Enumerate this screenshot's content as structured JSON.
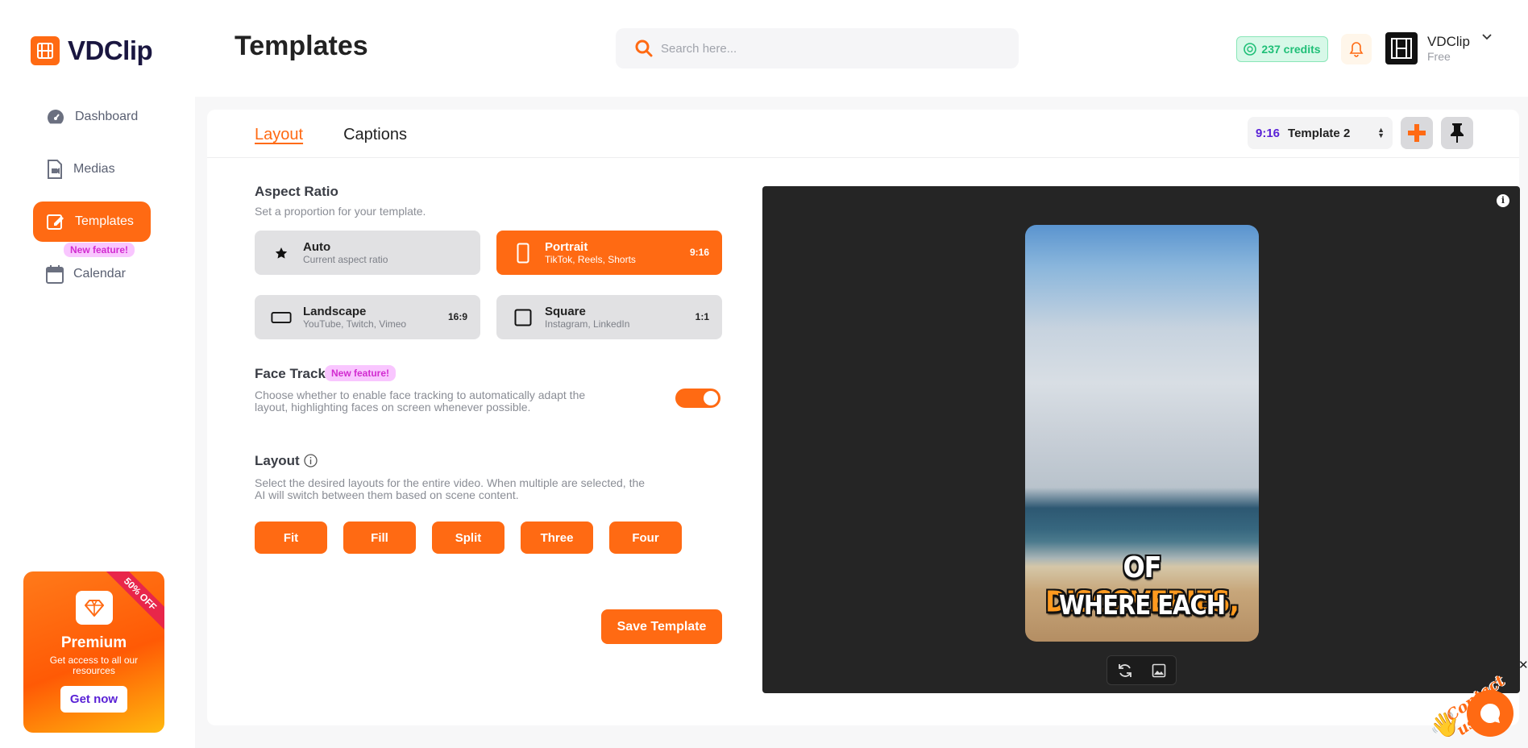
{
  "app": {
    "name": "VDClip"
  },
  "sidebar": {
    "items": [
      {
        "label": "Dashboard",
        "icon": "gauge-icon"
      },
      {
        "label": "Medias",
        "icon": "media-file-icon"
      },
      {
        "label": "Templates",
        "icon": "edit-icon",
        "active": true
      },
      {
        "label": "Calendar",
        "icon": "calendar-icon",
        "badge": "New feature!"
      }
    ],
    "promo": {
      "ribbon": "50% OFF",
      "title": "Premium",
      "subtitle": "Get access to all our resources",
      "button": "Get now"
    }
  },
  "header": {
    "title": "Templates",
    "search_placeholder": "Search here...",
    "credits": "237 credits",
    "user": {
      "name": "VDClip",
      "plan": "Free"
    }
  },
  "tabs": [
    {
      "label": "Layout",
      "active": true
    },
    {
      "label": "Captions",
      "active": false
    }
  ],
  "template_select": {
    "ratio": "9:16",
    "name": "Template 2"
  },
  "aspect_ratio": {
    "title": "Aspect Ratio",
    "description": "Set a proportion for your template.",
    "options": [
      {
        "label": "Auto",
        "sub": "Current aspect ratio",
        "tag": "",
        "icon": "star-icon",
        "active": false
      },
      {
        "label": "Portrait",
        "sub": "TikTok, Reels, Shorts",
        "tag": "9:16",
        "icon": "portrait-rect-icon",
        "active": true
      },
      {
        "label": "Landscape",
        "sub": "YouTube, Twitch, Vimeo",
        "tag": "16:9",
        "icon": "landscape-rect-icon",
        "active": false
      },
      {
        "label": "Square",
        "sub": "Instagram, LinkedIn",
        "tag": "1:1",
        "icon": "square-icon",
        "active": false
      }
    ]
  },
  "face_tracking": {
    "title": "Face Tracking",
    "badge": "New feature!",
    "description": "Choose whether to enable face tracking to automatically adapt the layout, highlighting faces on screen whenever possible.",
    "enabled": true
  },
  "layout": {
    "title": "Layout",
    "description": "Select the desired layouts for the entire video. When multiple are selected, the AI will switch between them based on scene content.",
    "options": [
      "Fit",
      "Fill",
      "Split",
      "Three",
      "Four"
    ]
  },
  "save_button": "Save Template",
  "preview": {
    "caption_line1_a": "OF",
    "caption_line1_b": "DISCOVERIES,",
    "caption_line2": "WHERE EACH"
  },
  "chat": {
    "label": "Contact us"
  },
  "colors": {
    "accent": "#ff6a13",
    "brand_dark": "#1a1640",
    "purple": "#5a22d6",
    "badge_pink": "#d22cd0",
    "credits_green": "#1fbf77"
  }
}
